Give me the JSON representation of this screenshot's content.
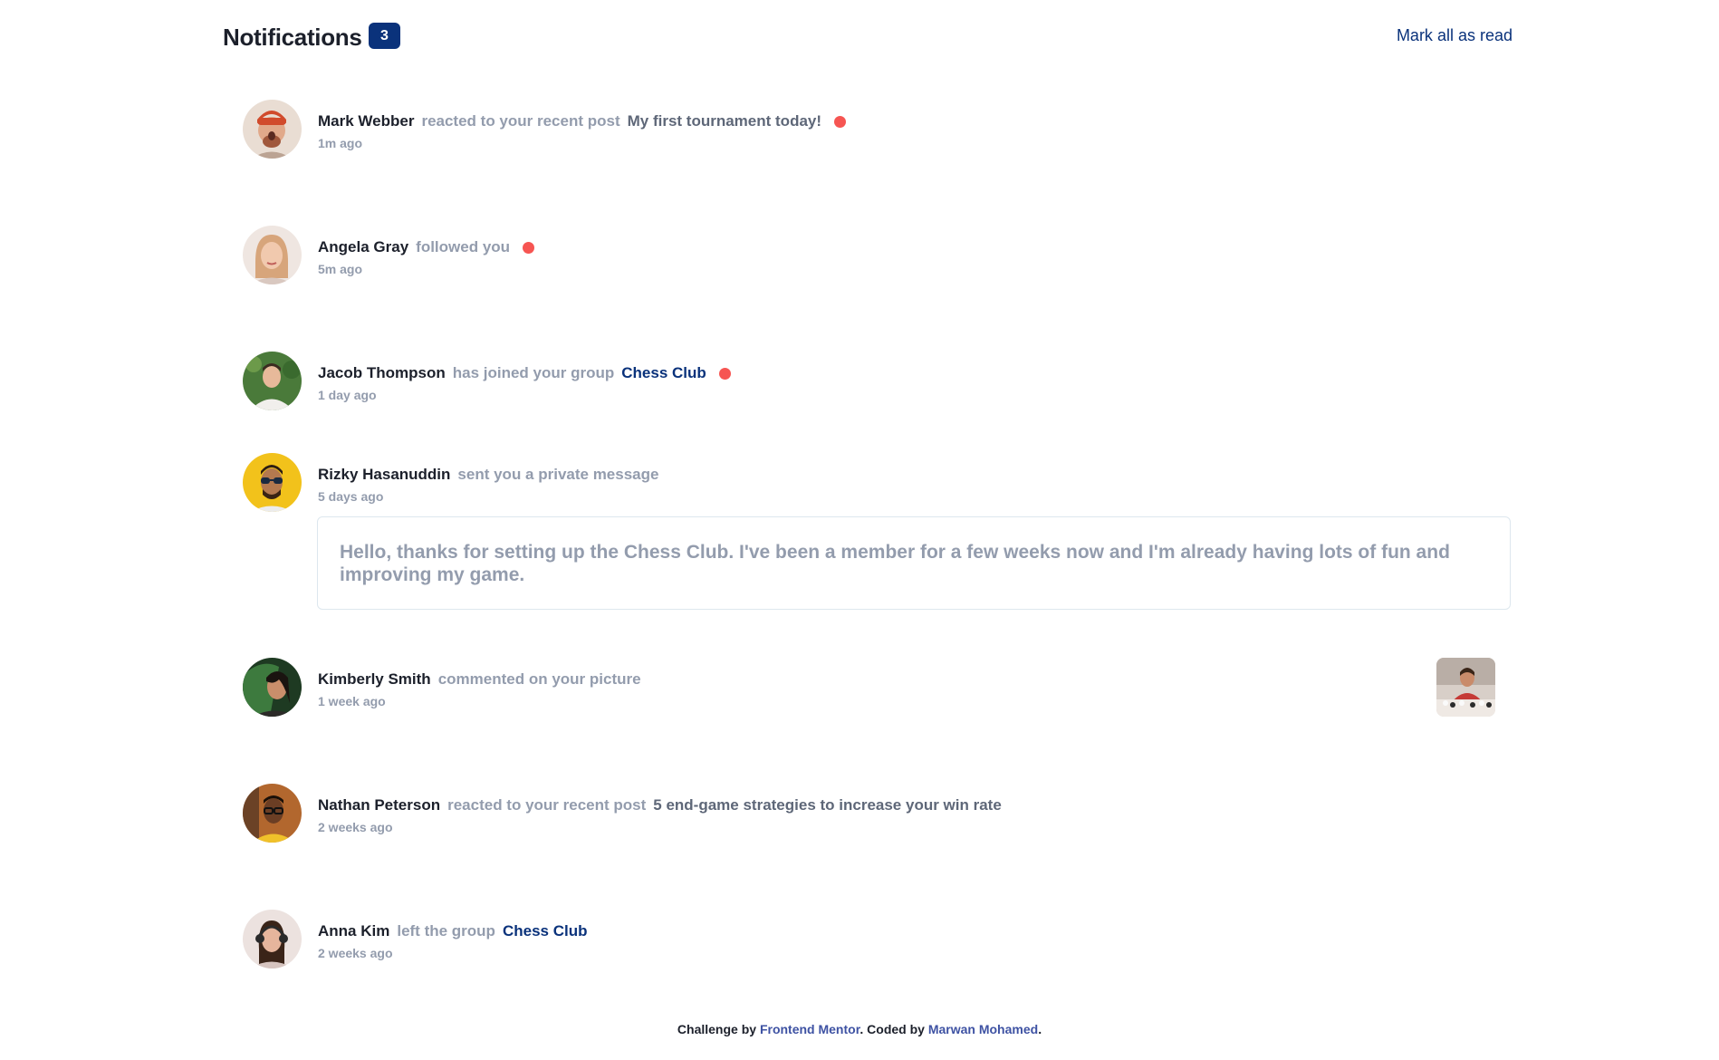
{
  "header": {
    "title": "Notifications",
    "unread_count": "3",
    "mark_all_label": "Mark all as read"
  },
  "notifications": [
    {
      "name": "Mark Webber",
      "action": "reacted to your recent post",
      "target": "My first tournament today!",
      "time": "1m ago",
      "unread": true
    },
    {
      "name": "Angela Gray",
      "action": "followed you",
      "target": "",
      "time": "5m ago",
      "unread": true
    },
    {
      "name": "Jacob Thompson",
      "action": "has joined your group",
      "target": "Chess Club",
      "time": "1 day ago",
      "unread": true
    },
    {
      "name": "Rizky Hasanuddin",
      "action": "sent you a private message",
      "target": "",
      "time": "5 days ago",
      "unread": false,
      "message": "Hello, thanks for setting up the Chess Club. I've been a member for a few weeks now and I'm already having lots of fun and improving my game."
    },
    {
      "name": "Kimberly Smith",
      "action": "commented on your picture",
      "target": "",
      "time": "1 week ago",
      "unread": false
    },
    {
      "name": "Nathan Peterson",
      "action": "reacted to your recent post",
      "target": "5 end-game strategies to increase your win rate",
      "time": "2 weeks ago",
      "unread": false
    },
    {
      "name": "Anna Kim",
      "action": "left the group",
      "target": "Chess Club",
      "time": "2 weeks ago",
      "unread": false
    }
  ],
  "footer": {
    "prefix": "Challenge by ",
    "link1": "Frontend Mentor",
    "middle": ". Coded by ",
    "link2": "Marwan Mohamed",
    "suffix": "."
  },
  "colors": {
    "accent": "#0a327b",
    "unread_dot": "#f65552",
    "muted": "#939cad",
    "post": "#5e6778",
    "footer_link": "#3e52a3"
  }
}
